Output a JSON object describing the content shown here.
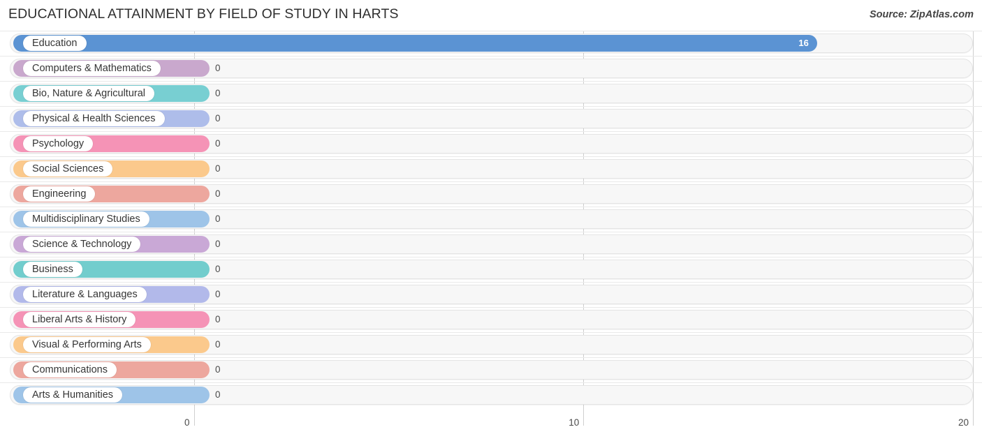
{
  "header": {
    "title": "EDUCATIONAL ATTAINMENT BY FIELD OF STUDY IN HARTS",
    "source": "Source: ZipAtlas.com"
  },
  "chart_data": {
    "type": "bar",
    "orientation": "horizontal",
    "title": "EDUCATIONAL ATTAINMENT BY FIELD OF STUDY IN HARTS",
    "xlabel": "",
    "ylabel": "",
    "xlim": [
      0,
      20
    ],
    "grid": true,
    "legend": "none",
    "xticks": [
      "0",
      "10",
      "20"
    ],
    "xtick_values": [
      0,
      10,
      20
    ],
    "categories": [
      "Education",
      "Computers & Mathematics",
      "Bio, Nature & Agricultural",
      "Physical & Health Sciences",
      "Psychology",
      "Social Sciences",
      "Engineering",
      "Multidisciplinary Studies",
      "Science & Technology",
      "Business",
      "Literature & Languages",
      "Liberal Arts & History",
      "Visual & Performing Arts",
      "Communications",
      "Arts & Humanities"
    ],
    "values": [
      16,
      0,
      0,
      0,
      0,
      0,
      0,
      0,
      0,
      0,
      0,
      0,
      0,
      0,
      0
    ],
    "value_labels": [
      "16",
      "0",
      "0",
      "0",
      "0",
      "0",
      "0",
      "0",
      "0",
      "0",
      "0",
      "0",
      "0",
      "0",
      "0"
    ],
    "colors": [
      "#5b93d3",
      "#c9a8cd",
      "#78cfd2",
      "#aebdea",
      "#f593b6",
      "#fbc98c",
      "#eda79e",
      "#9ec4e8",
      "#c9a8d6",
      "#72cdcd",
      "#b2b9ea",
      "#f593b6",
      "#fbc98c",
      "#eda79e",
      "#9ec4e8"
    ]
  }
}
